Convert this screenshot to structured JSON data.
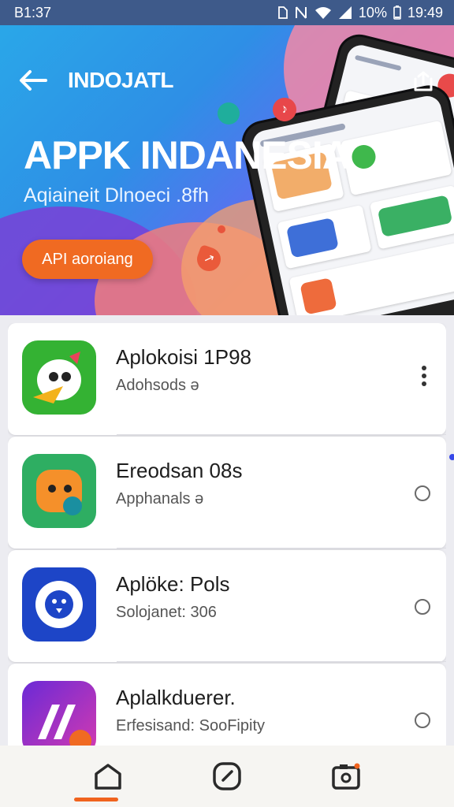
{
  "status_bar": {
    "time_left": "B1:37",
    "battery": "10%",
    "time_right": "19:49",
    "icons": [
      "sim-icon",
      "nfc-icon",
      "wifi-icon",
      "signal-icon",
      "battery-icon"
    ]
  },
  "banner": {
    "brand": "INDOJATL",
    "headline": "APPK INDANESIA",
    "subline": "Aqiaineit Dlnoeci .8fh",
    "cta_label": "API aoroiang",
    "page_dots": 2,
    "colors": {
      "cta": "#f06a22",
      "background": "#2e8fe6"
    }
  },
  "apps": [
    {
      "title": "Aplokoisi 1P98",
      "subtitle": "Adohsods",
      "subtitle_glyph": "ə",
      "action": "more-vert",
      "icon_color": "#34b233"
    },
    {
      "title": "Ereodsan 08s",
      "subtitle": "Apphanals",
      "subtitle_glyph": "ə",
      "action": "radio",
      "icon_color": "#2eae62"
    },
    {
      "title": "Aplöke: Pols",
      "subtitle": "Solojanet:",
      "subtitle_glyph": "306",
      "action": "radio",
      "icon_color": "#1d45c7"
    },
    {
      "title": "Aplalkduerer.",
      "subtitle": "Erfesisand:",
      "subtitle_glyph": "SooFipity",
      "action": "radio",
      "icon_color": "#6b2ad6"
    }
  ],
  "bottom_nav": {
    "items": [
      "home-icon",
      "explore-icon",
      "camera-icon"
    ],
    "active": "home-icon",
    "accent": "#f0631e"
  }
}
